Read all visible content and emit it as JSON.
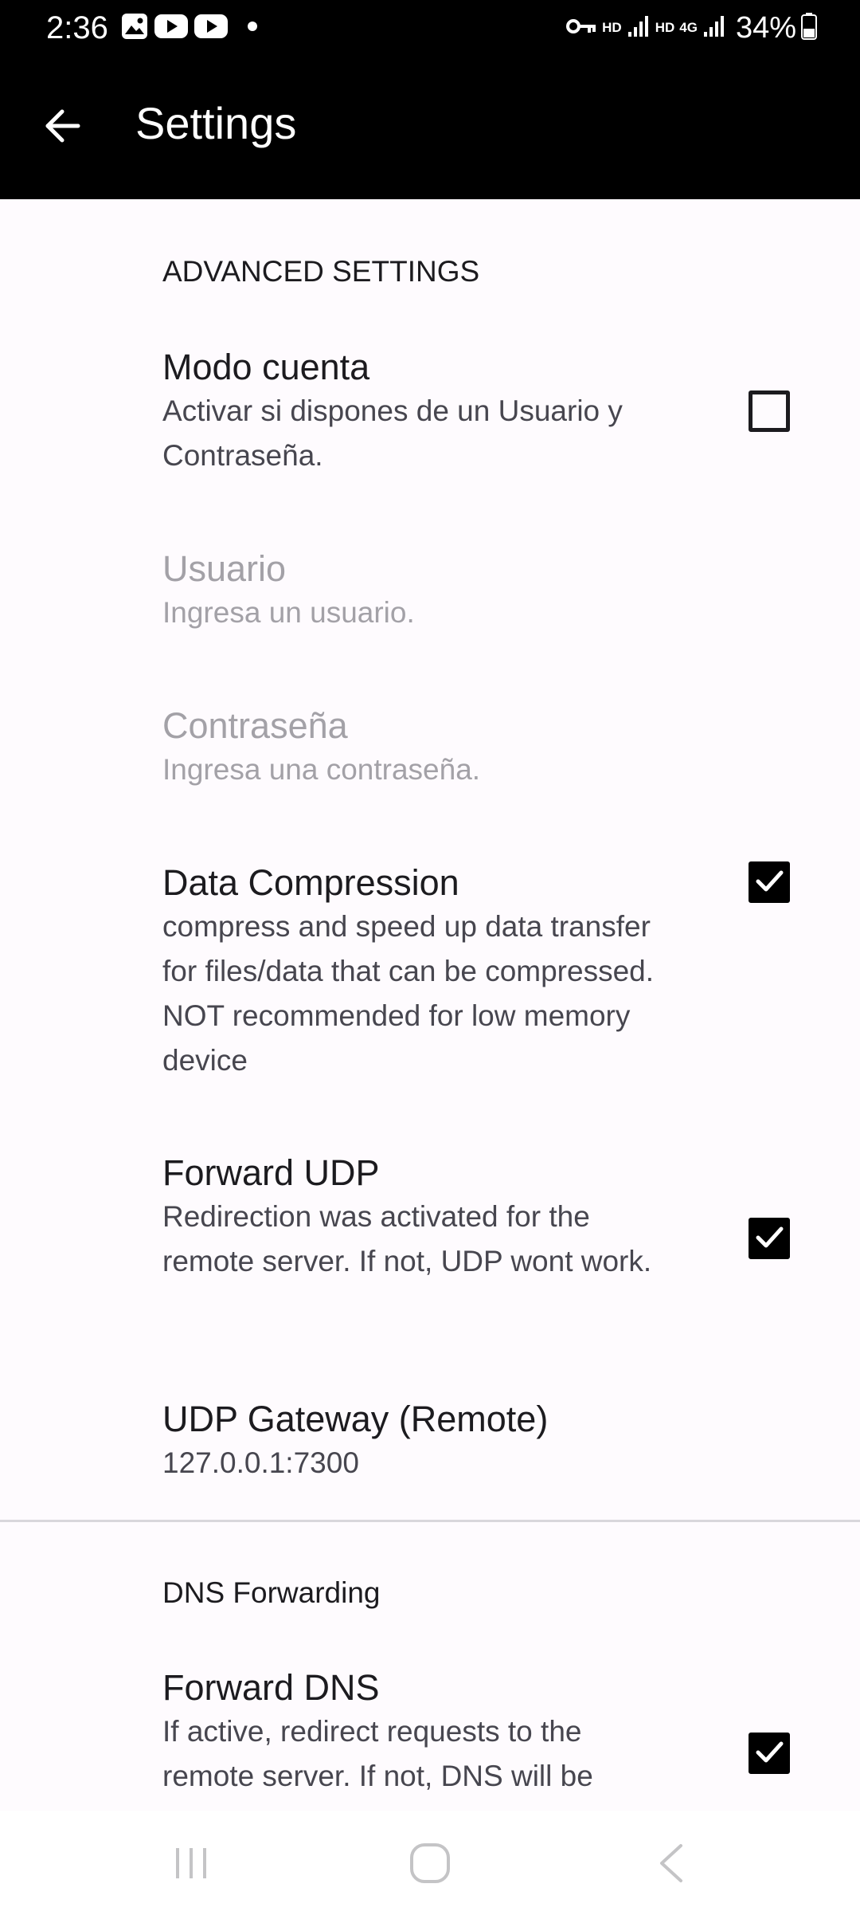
{
  "status_bar": {
    "time": "2:36",
    "left_icons": [
      "gallery-icon",
      "youtube-icon",
      "youtube-icon",
      "dot-icon"
    ],
    "right_icons": [
      "vpn-key-icon",
      "hd-icon",
      "signal-icon",
      "hd-icon",
      "4g-icon",
      "signal-icon",
      "battery-icon"
    ],
    "hd_label_1": "HD",
    "hd_label_2": "HD",
    "network_label": "4G",
    "battery_percent": "34%"
  },
  "app_bar": {
    "title": "Settings",
    "back_icon": "arrow-back-icon"
  },
  "advanced": {
    "category": "ADVANCED SETTINGS",
    "modo_cuenta": {
      "title": "Modo cuenta",
      "summary": "Activar si dispones de un Usuario y Contraseña.",
      "checked": false
    },
    "usuario": {
      "title": "Usuario",
      "summary": "Ingresa un usuario.",
      "enabled": false
    },
    "contrasena": {
      "title": "Contraseña",
      "summary": "Ingresa una contraseña.",
      "enabled": false
    },
    "data_compression": {
      "title": "Data Compression",
      "summary": "compress and speed up data transfer for files/data that can be compressed. NOT recommended for low memory device",
      "checked": true
    },
    "forward_udp": {
      "title": "Forward UDP",
      "summary": "Redirection was activated for the remote server. If not, UDP wont work.",
      "checked": true
    },
    "udp_gateway": {
      "title": "UDP Gateway (Remote)",
      "summary": "127.0.0.1:7300"
    }
  },
  "dns": {
    "category": "DNS Forwarding",
    "forward_dns": {
      "title": "Forward DNS",
      "summary": "If active, redirect requests to the remote server. If not, DNS will be",
      "checked": true
    }
  },
  "nav_bar": {
    "recents_icon": "recents-icon",
    "home_icon": "home-icon",
    "back_icon": "back-chevron-icon"
  },
  "colors": {
    "topbar": "#000000",
    "background": "#fefbfe",
    "text_primary": "#1c1b1f",
    "text_secondary": "#47464f",
    "text_disabled": "#a3a1a7",
    "checkbox_checked": "#000000"
  }
}
